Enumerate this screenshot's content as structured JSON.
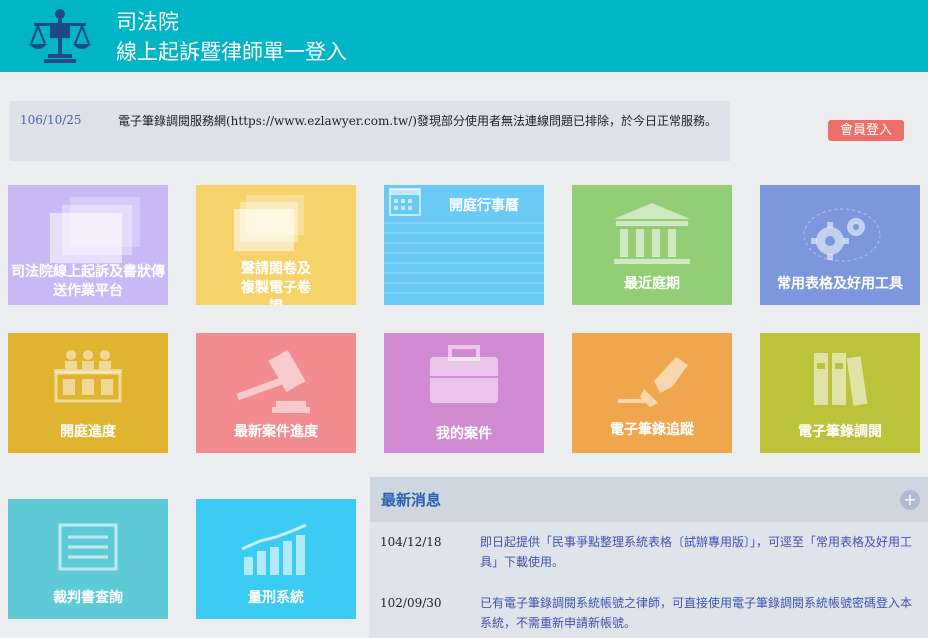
{
  "header": {
    "title_line1": "司法院",
    "title_line2": "線上起訴暨律師單一登入",
    "logo_icon": "justice-scale-icon",
    "bg_color": "#00b5c6"
  },
  "notice": {
    "date": "106/10/25",
    "text": "電子筆錄調閱服務網(https://www.ezlawyer.com.tw/)發現部分使用者無法連線問題已排除，於今日正常服務。"
  },
  "login": {
    "label": "會員登入",
    "color": "#ec6f68"
  },
  "tiles": [
    {
      "label": "司法院線上起訴及書狀傳送作業平台",
      "icon": "documents-stack-icon",
      "color": "#c9b9f6"
    },
    {
      "label": "聲請閱卷及複製電子卷證",
      "icon": "documents-stack-icon",
      "color": "#f5d26a"
    },
    {
      "label": "開庭行事曆",
      "icon": "calendar-icon",
      "color": "#6bc9f5"
    },
    {
      "label": "最近庭期",
      "icon": "courthouse-icon",
      "color": "#93cd76"
    },
    {
      "label": "常用表格及好用工具",
      "icon": "gears-icon",
      "color": "#7c97dc"
    },
    {
      "label": "開庭進度",
      "icon": "courtroom-icon",
      "color": "#e0b42e"
    },
    {
      "label": "最新案件進度",
      "icon": "gavel-icon",
      "color": "#f28c90"
    },
    {
      "label": "我的案件",
      "icon": "briefcase-icon",
      "color": "#d08bd2"
    },
    {
      "label": "電子筆錄追蹤",
      "icon": "pen-nib-icon",
      "color": "#f0a64d"
    },
    {
      "label": "電子筆錄調閱",
      "icon": "binders-icon",
      "color": "#bcc23a"
    },
    {
      "label": "裁判書查詢",
      "icon": "document-lines-icon",
      "color": "#5dcad6"
    },
    {
      "label": "量刑系統",
      "icon": "bar-chart-icon",
      "color": "#3ccbf3"
    }
  ],
  "news": {
    "title": "最新消息",
    "more": "+",
    "items": [
      {
        "date": "104/12/18",
        "text": "即日起提供「民事爭點整理系統表格〔試辦專用版〕」，可逕至「常用表格及好用工具」下載使用。"
      },
      {
        "date": "102/09/30",
        "text": "已有電子筆錄調閱系統帳號之律師，可直接使用電子筆錄調閱系統帳號密碼登入本系統，不需重新申請新帳號。"
      }
    ]
  }
}
